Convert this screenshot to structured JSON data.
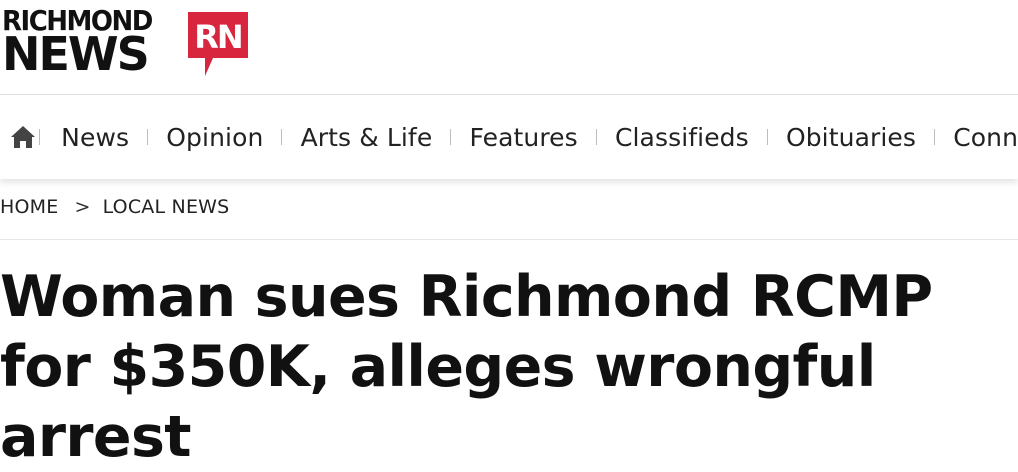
{
  "logo": {
    "line1": "RICHMOND",
    "line2": "NEWS",
    "badge": "RN",
    "badge_color": "#d7263d"
  },
  "nav": {
    "home_icon": "home-icon",
    "items": [
      {
        "label": "News"
      },
      {
        "label": "Opinion"
      },
      {
        "label": "Arts & Life"
      },
      {
        "label": "Features"
      },
      {
        "label": "Classifieds"
      },
      {
        "label": "Obituaries"
      },
      {
        "label": "Conn"
      }
    ]
  },
  "breadcrumb": {
    "home": "HOME",
    "separator": ">",
    "section": "LOCAL NEWS"
  },
  "article": {
    "headline": "Woman sues Richmond RCMP for $350K, alleges wrongful arrest"
  }
}
